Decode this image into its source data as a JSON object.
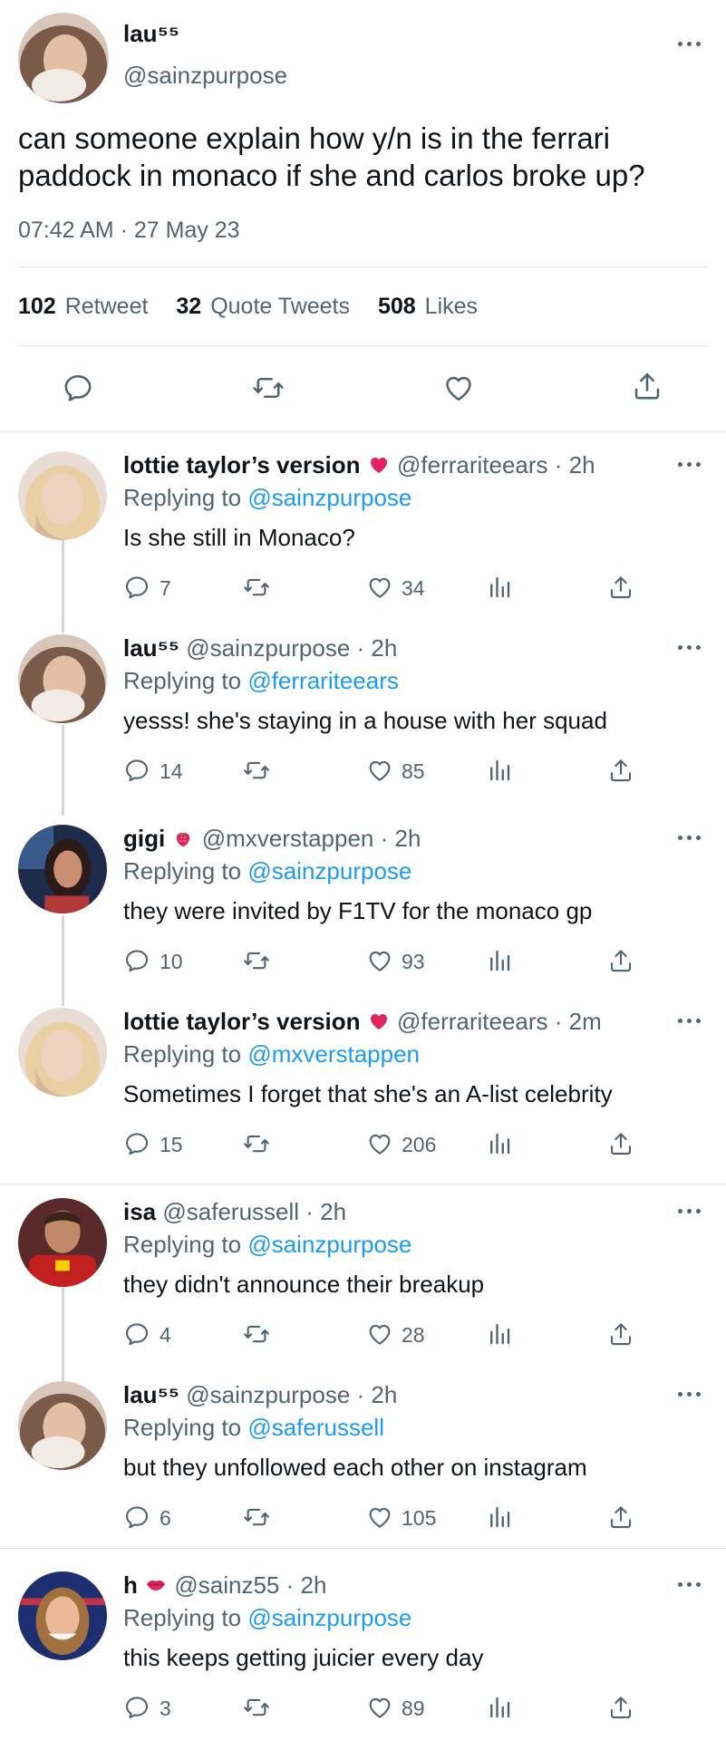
{
  "main_tweet": {
    "name": "lau⁵⁵",
    "handle": "@sainzpurpose",
    "text_line1": "can someone explain how y/n is in the ferrari",
    "text_line2": "paddock in monaco if she and carlos broke up?",
    "timestamp": "07:42 AM · 27 May 23",
    "stats": {
      "retweets": "102",
      "retweets_label": "Retweet",
      "quotes": "32",
      "quotes_label": "Quote Tweets",
      "likes": "508",
      "likes_label": "Likes"
    },
    "actions": [
      "reply-icon",
      "retweet-icon",
      "like-icon",
      "share-icon"
    ]
  },
  "replies": [
    {
      "name": "lottie taylor’s version",
      "badge": "red-heart",
      "handle": "@ferrariteears",
      "time": "· 2h",
      "replying_label": "Replying to",
      "replying_to": "@sainzpurpose",
      "text": "Is she still in Monaco?",
      "replies": "7",
      "retweets": "",
      "likes": "34"
    },
    {
      "name": "lau⁵⁵",
      "badge": "",
      "handle": "@sainzpurpose",
      "time": "· 2h",
      "replying_label": "Replying to",
      "replying_to": "@ferrariteears",
      "text": "yesss! she's staying in a house with her squad",
      "replies": "14",
      "retweets": "",
      "likes": "85"
    },
    {
      "name": "gigi",
      "badge": "strawberry",
      "handle": "@mxverstappen",
      "time": "· 2h",
      "replying_label": "Replying to",
      "replying_to": "@sainzpurpose",
      "text": "they were invited by F1TV for the monaco gp",
      "replies": "10",
      "retweets": "",
      "likes": "93"
    },
    {
      "name": "lottie taylor’s version",
      "badge": "red-heart",
      "handle": "@ferrariteears",
      "time": "· 2m",
      "replying_label": "Replying to",
      "replying_to": "@mxverstappen",
      "text": "Sometimes I forget that she's an A-list celebrity",
      "replies": "15",
      "retweets": "",
      "likes": "206"
    },
    {
      "name": "isa",
      "badge": "",
      "handle": "@saferussell",
      "time": "· 2h",
      "replying_label": "Replying to",
      "replying_to": "@sainzpurpose",
      "text": "they didn't announce their breakup",
      "replies": "4",
      "retweets": "",
      "likes": "28"
    },
    {
      "name": "lau⁵⁵",
      "badge": "",
      "handle": "@sainzpurpose",
      "time": "· 2h",
      "replying_label": "Replying to",
      "replying_to": "@saferussell",
      "text": "but they unfollowed each other on instagram",
      "replies": "6",
      "retweets": "",
      "likes": "105"
    },
    {
      "name": "h",
      "badge": "kiss-lips",
      "handle": "@sainz55",
      "time": "· 2h",
      "replying_label": "Replying to",
      "replying_to": "@sainzpurpose",
      "text": "this keeps getting juicier every day",
      "replies": "3",
      "retweets": "",
      "likes": "89"
    }
  ],
  "colors": {
    "accent": "#1d9bf0",
    "text": "#0f1419",
    "muted": "#536471",
    "divider": "#e4e6e8",
    "heart": "#e0245e"
  }
}
